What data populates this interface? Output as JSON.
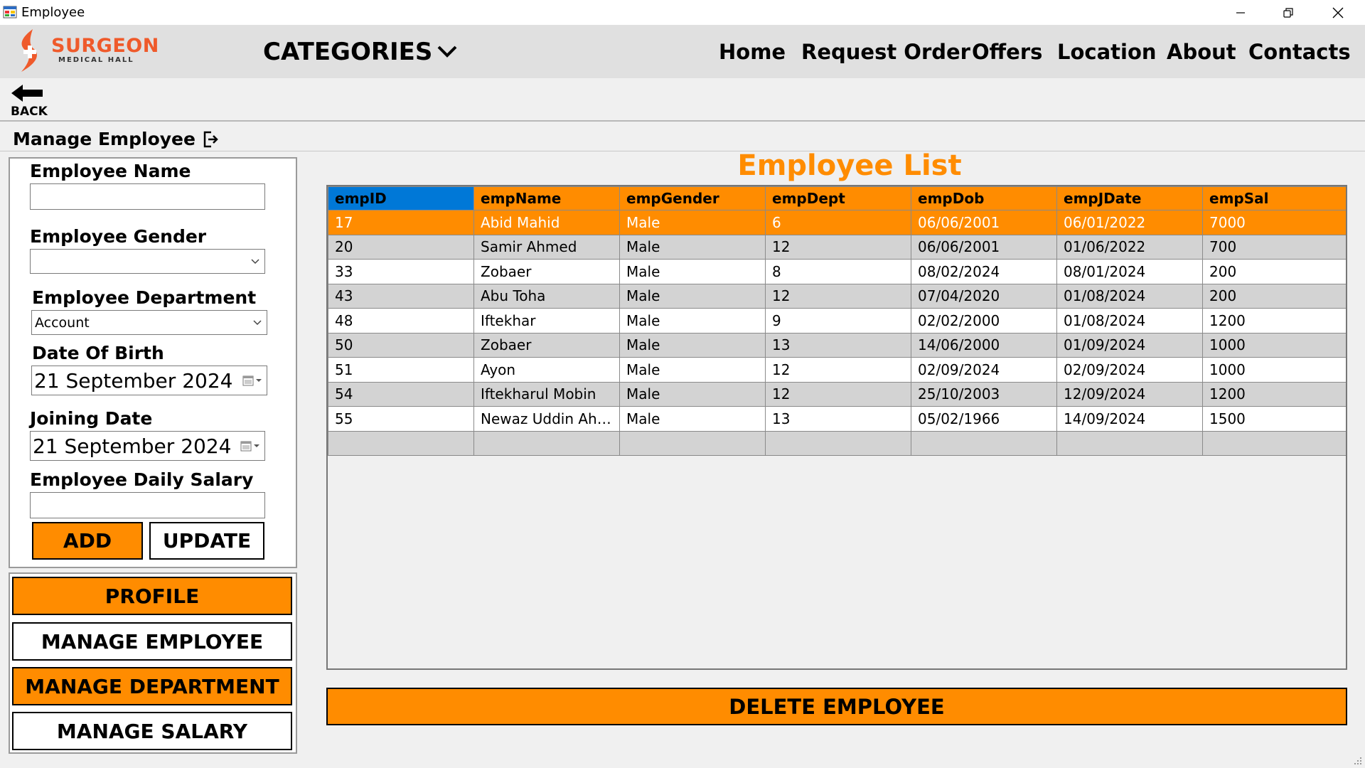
{
  "window": {
    "title": "Employee"
  },
  "header": {
    "logo_brand": "SURGEON",
    "logo_sub": "MEDICAL HALL",
    "categories": "CATEGORIES",
    "nav": [
      "Home",
      "Request Order",
      "Offers",
      "Location",
      "About",
      "Contacts"
    ]
  },
  "back": {
    "label": "BACK"
  },
  "page": {
    "title": "Manage Employee"
  },
  "form": {
    "name_label": "Employee Name",
    "name_value": "",
    "gender_label": "Employee Gender",
    "gender_value": "",
    "dept_label": "Employee Department",
    "dept_value": "Account",
    "dob_label": "Date Of Birth",
    "dob_value": "21 September 2024",
    "join_label": "Joining Date",
    "join_value": "21 September 2024",
    "salary_label": "Employee Daily Salary",
    "salary_value": "",
    "add_label": "ADD",
    "update_label": "UPDATE"
  },
  "sidenav": {
    "profile": "PROFILE",
    "manage_employee": "MANAGE EMPLOYEE",
    "manage_department": "MANAGE DEPARTMENT",
    "manage_salary": "MANAGE SALARY"
  },
  "list": {
    "title": "Employee List",
    "columns": [
      "empID",
      "empName",
      "empGender",
      "empDept",
      "empDob",
      "empJDate",
      "empSal"
    ],
    "rows": [
      [
        "17",
        "Abid Mahid",
        "Male",
        "6",
        "06/06/2001",
        "06/01/2022",
        "7000"
      ],
      [
        "20",
        "Samir Ahmed",
        "Male",
        "12",
        "06/06/2001",
        "01/06/2022",
        "700"
      ],
      [
        "33",
        "Zobaer",
        "Male",
        "8",
        "08/02/2024",
        "08/01/2024",
        "200"
      ],
      [
        "43",
        "Abu Toha",
        "Male",
        "12",
        "07/04/2020",
        "01/08/2024",
        "200"
      ],
      [
        "48",
        "Iftekhar",
        "Male",
        "9",
        "02/02/2000",
        "01/08/2024",
        "1200"
      ],
      [
        "50",
        "Zobaer",
        "Male",
        "13",
        "14/06/2000",
        "01/09/2024",
        "1000"
      ],
      [
        "51",
        "Ayon",
        "Male",
        "12",
        "02/09/2024",
        "02/09/2024",
        "1000"
      ],
      [
        "54",
        "Iftekharul Mobin",
        "Male",
        "12",
        "25/10/2003",
        "12/09/2024",
        "1200"
      ],
      [
        "55",
        "Newaz Uddin Ahm...",
        "Male",
        "13",
        "05/02/1966",
        "14/09/2024",
        "1500"
      ]
    ],
    "selected_row": 0
  },
  "delete_label": "DELETE EMPLOYEE",
  "colors": {
    "accent": "#ff8c00",
    "selection": "#0078d7",
    "brand": "#ef5a2b"
  }
}
